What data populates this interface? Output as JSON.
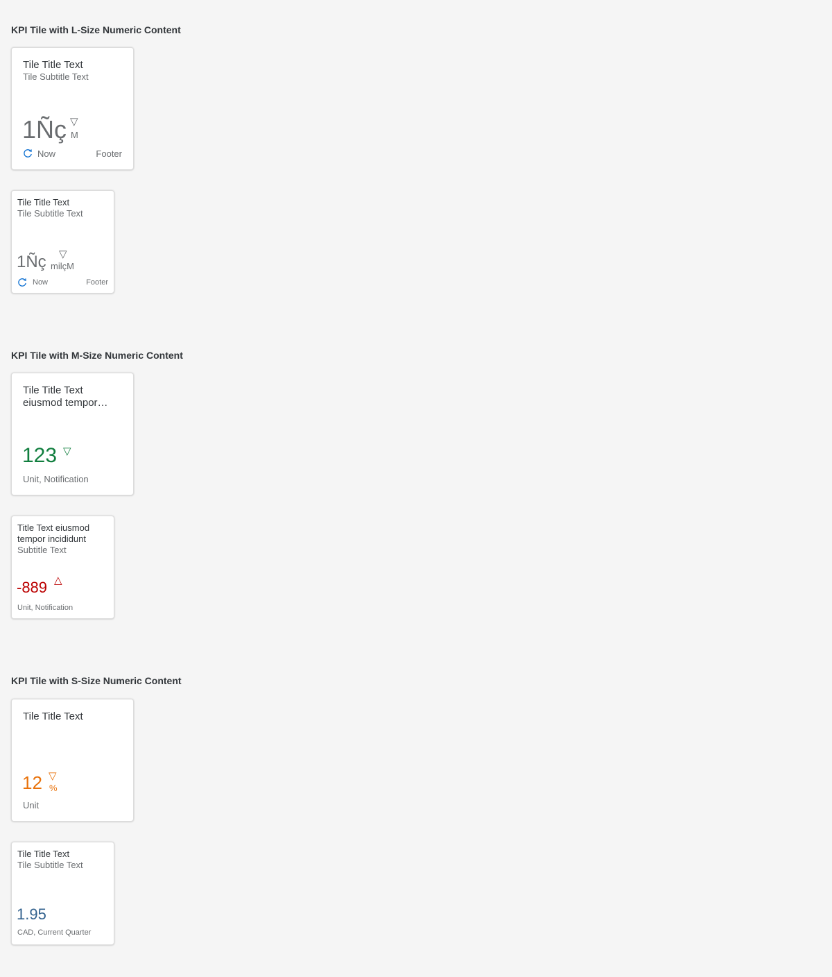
{
  "sections": [
    {
      "title": "KPI Tile with L-Size Numeric Content"
    },
    {
      "title": "KPI Tile with M-Size Numeric Content"
    },
    {
      "title": "KPI Tile with S-Size Numeric Content"
    }
  ],
  "tiles": [
    {
      "title": "Tile Title Text",
      "subtitle": "Tile Subtitle Text",
      "value": "1Ñç",
      "indicator": "▽",
      "scale": "M",
      "footer_time": "Now",
      "footer": "Footer",
      "value_color": "#6a6d70"
    },
    {
      "title": "Tile Title Text",
      "subtitle": "Tile Subtitle Text",
      "value": "1Ñç",
      "indicator": "▽",
      "scale": "milçM",
      "footer_time": "Now",
      "footer": "Footer",
      "value_color": "#6a6d70"
    },
    {
      "title": "Tile Title Text",
      "subtitle": "eiusmod tempor…",
      "value": "123",
      "indicator": "▽",
      "footer": "Unit, Notification",
      "value_color": "#107e3e"
    },
    {
      "title_line1": "Title Text eiusmod",
      "title_line2": "tempor incididunt",
      "subtitle": "Subtitle Text",
      "value": "-889",
      "indicator": "△",
      "footer": "Unit, Notification",
      "value_color": "#bb0000"
    },
    {
      "title": "Tile Title Text",
      "value": "12",
      "indicator": "▽",
      "scale": "%",
      "footer": "Unit",
      "value_color": "#e9730c"
    },
    {
      "title": "Tile Title Text",
      "subtitle": "Tile Subtitle Text",
      "value": "1.95",
      "footer": "CAD, Current Quarter",
      "value_color": "#34638f"
    }
  ]
}
